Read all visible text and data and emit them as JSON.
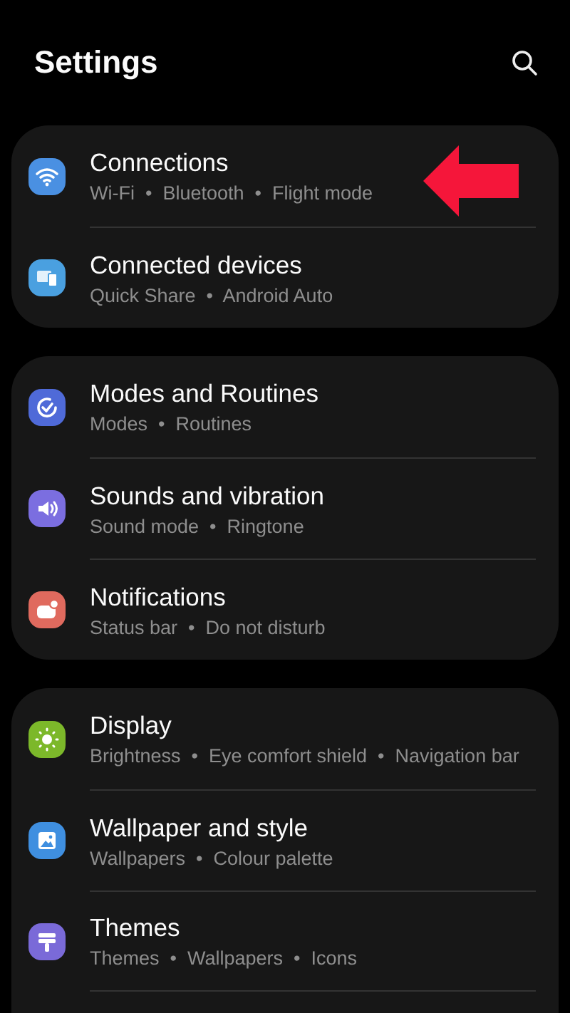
{
  "header": {
    "title": "Settings"
  },
  "groups": [
    {
      "items": [
        {
          "kind": "wifi",
          "color": "#4a90e2",
          "title": "Connections",
          "subtitle": "Wi-Fi  •  Bluetooth  •  Flight mode",
          "annotated": true
        },
        {
          "kind": "devices",
          "color": "#4aa0e0",
          "title": "Connected devices",
          "subtitle": "Quick Share  •  Android Auto",
          "annotated": false
        }
      ]
    },
    {
      "items": [
        {
          "kind": "modes",
          "color": "#4f6ad8",
          "title": "Modes and Routines",
          "subtitle": "Modes  •  Routines",
          "annotated": false
        },
        {
          "kind": "sound",
          "color": "#7b6ee0",
          "title": "Sounds and vibration",
          "subtitle": "Sound mode  •  Ringtone",
          "annotated": false
        },
        {
          "kind": "notifications",
          "color": "#e06a5e",
          "title": "Notifications",
          "subtitle": "Status bar  •  Do not disturb",
          "annotated": false
        }
      ]
    },
    {
      "items": [
        {
          "kind": "display",
          "color": "#7cb82a",
          "title": "Display",
          "subtitle": "Brightness  •  Eye comfort shield  •  Navigation bar",
          "annotated": false
        },
        {
          "kind": "wallpaper",
          "color": "#3f8fe0",
          "title": "Wallpaper and style",
          "subtitle": "Wallpapers  •  Colour palette",
          "annotated": false
        },
        {
          "kind": "themes",
          "color": "#7a6ad8",
          "title": "Themes",
          "subtitle": "Themes  •  Wallpapers  •  Icons",
          "annotated": false
        }
      ]
    }
  ]
}
